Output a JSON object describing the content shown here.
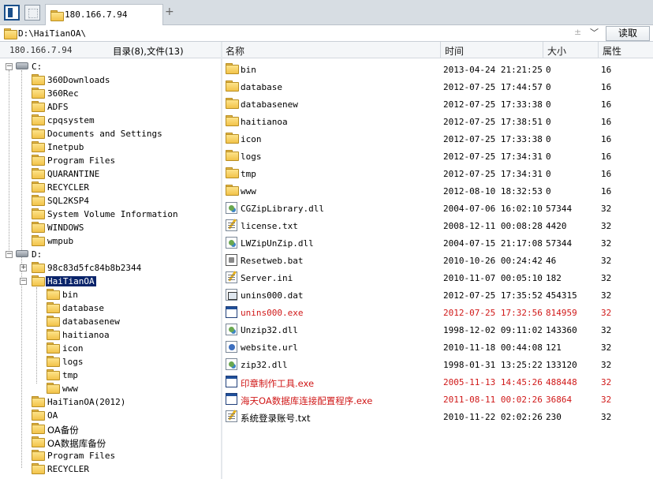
{
  "tab": {
    "label": "180.166.7.94"
  },
  "address": {
    "path": "D:\\HaiTianOA\\",
    "read_button": "读取",
    "pin_glyph": "±",
    "dropdown_glyph": "﹀"
  },
  "left_header": {
    "ip": "180.166.7.94",
    "summary": "目录(8),文件(13)"
  },
  "columns": {
    "name": "名称",
    "time": "时间",
    "size": "大小",
    "attr": "属性"
  },
  "tree": {
    "drive_c": "C:",
    "c_folders": [
      "360Downloads",
      "360Rec",
      "ADFS",
      "cpqsystem",
      "Documents and Settings",
      "Inetpub",
      "Program Files",
      "QUARANTINE",
      "RECYCLER",
      "SQL2KSP4",
      "System Volume Information",
      "WINDOWS",
      "wmpub"
    ],
    "drive_d": "D:",
    "d_folder_hash": "98c83d5fc84b8b2344",
    "d_selected": "HaiTianOA",
    "haitian_children": [
      "bin",
      "database",
      "databasenew",
      "haitianoa",
      "icon",
      "logs",
      "tmp",
      "www"
    ],
    "d_folders_after": [
      "HaiTianOA(2012)",
      "OA",
      "OA备份",
      "OA数据库备份",
      "Program Files",
      "RECYCLER"
    ]
  },
  "files": [
    {
      "name": "bin",
      "time": "2013-04-24 21:21:25",
      "size": "0",
      "attr": "16",
      "icon": "folder-icon",
      "red": false
    },
    {
      "name": "database",
      "time": "2012-07-25 17:44:57",
      "size": "0",
      "attr": "16",
      "icon": "folder-icon",
      "red": false
    },
    {
      "name": "databasenew",
      "time": "2012-07-25 17:33:38",
      "size": "0",
      "attr": "16",
      "icon": "folder-icon",
      "red": false
    },
    {
      "name": "haitianoa",
      "time": "2012-07-25 17:38:51",
      "size": "0",
      "attr": "16",
      "icon": "folder-icon",
      "red": false
    },
    {
      "name": "icon",
      "time": "2012-07-25 17:33:38",
      "size": "0",
      "attr": "16",
      "icon": "folder-icon",
      "red": false
    },
    {
      "name": "logs",
      "time": "2012-07-25 17:34:31",
      "size": "0",
      "attr": "16",
      "icon": "folder-icon",
      "red": false
    },
    {
      "name": "tmp",
      "time": "2012-07-25 17:34:31",
      "size": "0",
      "attr": "16",
      "icon": "folder-icon",
      "red": false
    },
    {
      "name": "www",
      "time": "2012-08-10 18:32:53",
      "size": "0",
      "attr": "16",
      "icon": "folder-icon",
      "red": false
    },
    {
      "name": "CGZipLibrary.dll",
      "time": "2004-07-06 16:02:10",
      "size": "57344",
      "attr": "32",
      "icon": "dll-file-icon",
      "red": false
    },
    {
      "name": "license.txt",
      "time": "2008-12-11 00:08:28",
      "size": "4420",
      "attr": "32",
      "icon": "text-file-icon",
      "red": false
    },
    {
      "name": "LWZipUnZip.dll",
      "time": "2004-07-15 21:17:08",
      "size": "57344",
      "attr": "32",
      "icon": "dll-file-icon",
      "red": false
    },
    {
      "name": "Resetweb.bat",
      "time": "2010-10-26 00:24:42",
      "size": "46",
      "attr": "32",
      "icon": "batch-file-icon",
      "red": false
    },
    {
      "name": "Server.ini",
      "time": "2010-11-07 00:05:10",
      "size": "182",
      "attr": "32",
      "icon": "ini-file-icon",
      "red": false
    },
    {
      "name": "unins000.dat",
      "time": "2012-07-25 17:35:52",
      "size": "454315",
      "attr": "32",
      "icon": "dat-file-icon",
      "red": false
    },
    {
      "name": "unins000.exe",
      "time": "2012-07-25 17:32:56",
      "size": "814959",
      "attr": "32",
      "icon": "exe-file-icon",
      "red": true
    },
    {
      "name": "Unzip32.dll",
      "time": "1998-12-02 09:11:02",
      "size": "143360",
      "attr": "32",
      "icon": "dll-file-icon",
      "red": false
    },
    {
      "name": "website.url",
      "time": "2010-11-18 00:44:08",
      "size": "121",
      "attr": "32",
      "icon": "url-file-icon",
      "red": false
    },
    {
      "name": "zip32.dll",
      "time": "1998-01-31 13:25:22",
      "size": "133120",
      "attr": "32",
      "icon": "dll-file-icon",
      "red": false
    },
    {
      "name": "印章制作工具.exe",
      "time": "2005-11-13 14:45:26",
      "size": "488448",
      "attr": "32",
      "icon": "exe-file-icon",
      "red": true
    },
    {
      "name": "海天OA数据库连接配置程序.exe",
      "time": "2011-08-11 00:02:26",
      "size": "36864",
      "attr": "32",
      "icon": "exe-file-icon",
      "red": true
    },
    {
      "name": "系统登录账号.txt",
      "time": "2010-11-22 02:02:26",
      "size": "230",
      "attr": "32",
      "icon": "text-file-icon",
      "red": false
    }
  ],
  "colors": {
    "selection": "#0a246a",
    "red_text": "#d01818",
    "folder_yellow": "#f2c34a"
  }
}
